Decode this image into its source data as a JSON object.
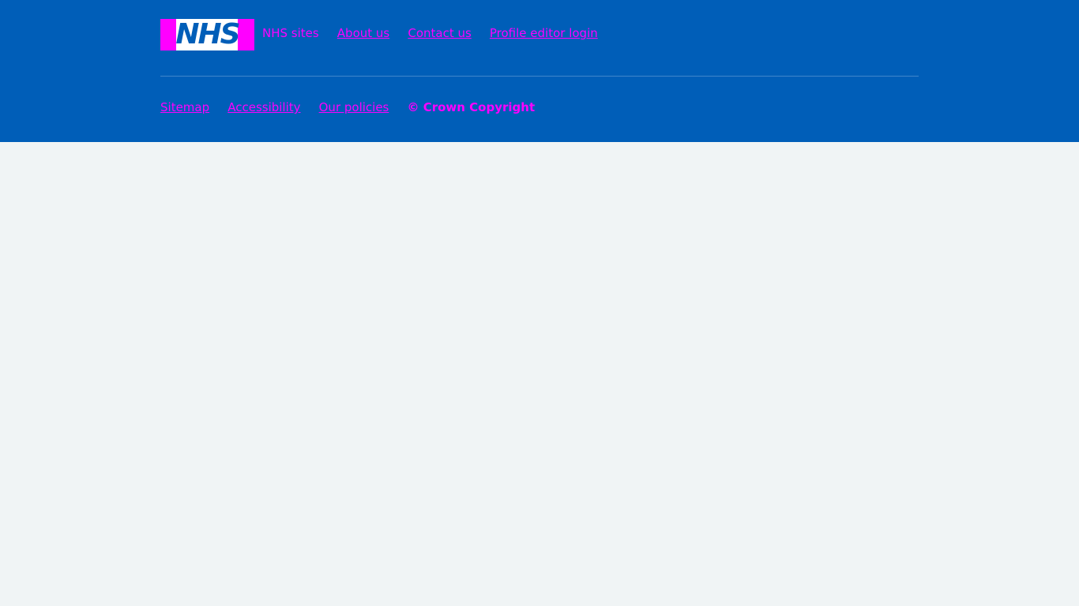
{
  "logo": {
    "text": "NHS"
  },
  "footer": {
    "top_links": [
      {
        "label": "NHS sites"
      },
      {
        "label": "About us"
      },
      {
        "label": "Contact us"
      },
      {
        "label": "Profile editor login"
      }
    ],
    "bottom_links": [
      {
        "label": "Sitemap"
      },
      {
        "label": "Accessibility"
      },
      {
        "label": "Our policies"
      }
    ],
    "copyright": "© Crown Copyright"
  },
  "colors": {
    "footer_bg": "#005eb8",
    "page_bg": "#f0f4f5",
    "link": "#ff00ff"
  }
}
